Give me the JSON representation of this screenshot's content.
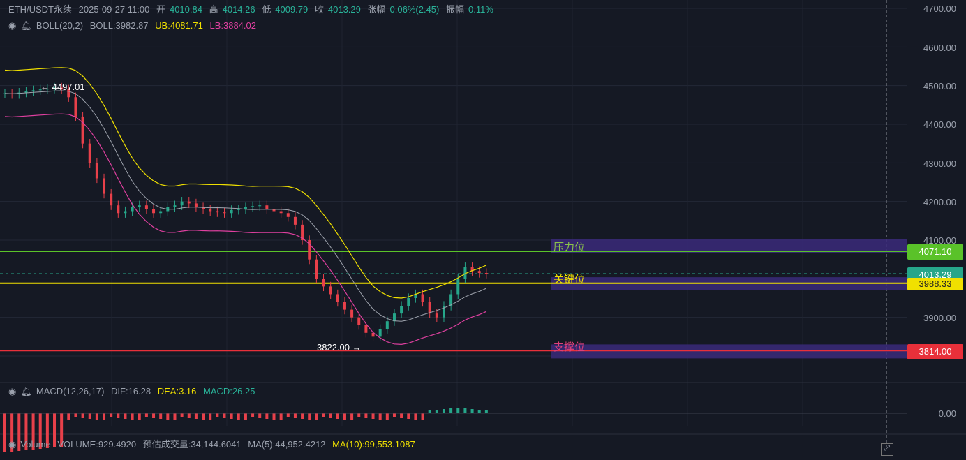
{
  "header": {
    "symbol": "ETH/USDT永续",
    "datetime": "2025-09-27 11:00",
    "open_label": "开",
    "open": "4010.84",
    "high_label": "高",
    "high": "4014.26",
    "low_label": "低",
    "low": "4009.79",
    "close_label": "收",
    "close": "4013.29",
    "change_label": "张幅",
    "change": "0.06%(2.45)",
    "amp_label": "振幅",
    "amp": "0.11%"
  },
  "boll": {
    "name": "BOLL(20,2)",
    "mid": "BOLL:3982.87",
    "ub": "UB:4081.71",
    "lb": "LB:3884.02"
  },
  "macd": {
    "name": "MACD(12,26,17)",
    "dif": "DIF:16.28",
    "dea": "DEA:3.16",
    "macd": "MACD:26.25"
  },
  "volume": {
    "name": "Volume",
    "vol": "VOLUME:929.4920",
    "est": "预估成交量:34,144.6041",
    "ma5": "MA(5):44,952.4212",
    "ma10": "MA(10):99,553.1087"
  },
  "annotations": {
    "high_marker": "← 4497.01",
    "low_marker": "3822.00 →"
  },
  "zones": {
    "resistance": "压力位",
    "key": "关键位",
    "support": "支撑位"
  },
  "price_tags": {
    "resistance": "4071.10",
    "current": "4013.29",
    "key": "3988.33",
    "support": "3814.00"
  },
  "axis": {
    "ticks": [
      "4700.00",
      "4600.00",
      "4500.00",
      "4400.00",
      "4300.00",
      "4200.00",
      "4100.00",
      "3900.00"
    ],
    "macd_zero": "0.00"
  },
  "chart_data": {
    "type": "candlestick",
    "ylim": [
      3770,
      4710
    ],
    "close_path": [
      4480,
      4478,
      4482,
      4485,
      4488,
      4490,
      4492,
      4495,
      4490,
      4470,
      4420,
      4350,
      4300,
      4260,
      4220,
      4190,
      4170,
      4175,
      4185,
      4190,
      4180,
      4170,
      4175,
      4185,
      4190,
      4200,
      4195,
      4185,
      4180,
      4175,
      4172,
      4170,
      4178,
      4180,
      4185,
      4188,
      4190,
      4180,
      4175,
      4170,
      4160,
      4140,
      4100,
      4050,
      4000,
      3980,
      3960,
      3940,
      3920,
      3900,
      3880,
      3860,
      3850,
      3870,
      3890,
      3910,
      3930,
      3950,
      3960,
      3940,
      3910,
      3900,
      3930,
      3960,
      4000,
      4030,
      4020,
      4015,
      4013
    ],
    "key_levels": [
      4071.1,
      3988.33,
      3814.0
    ],
    "current": 4013.29
  }
}
